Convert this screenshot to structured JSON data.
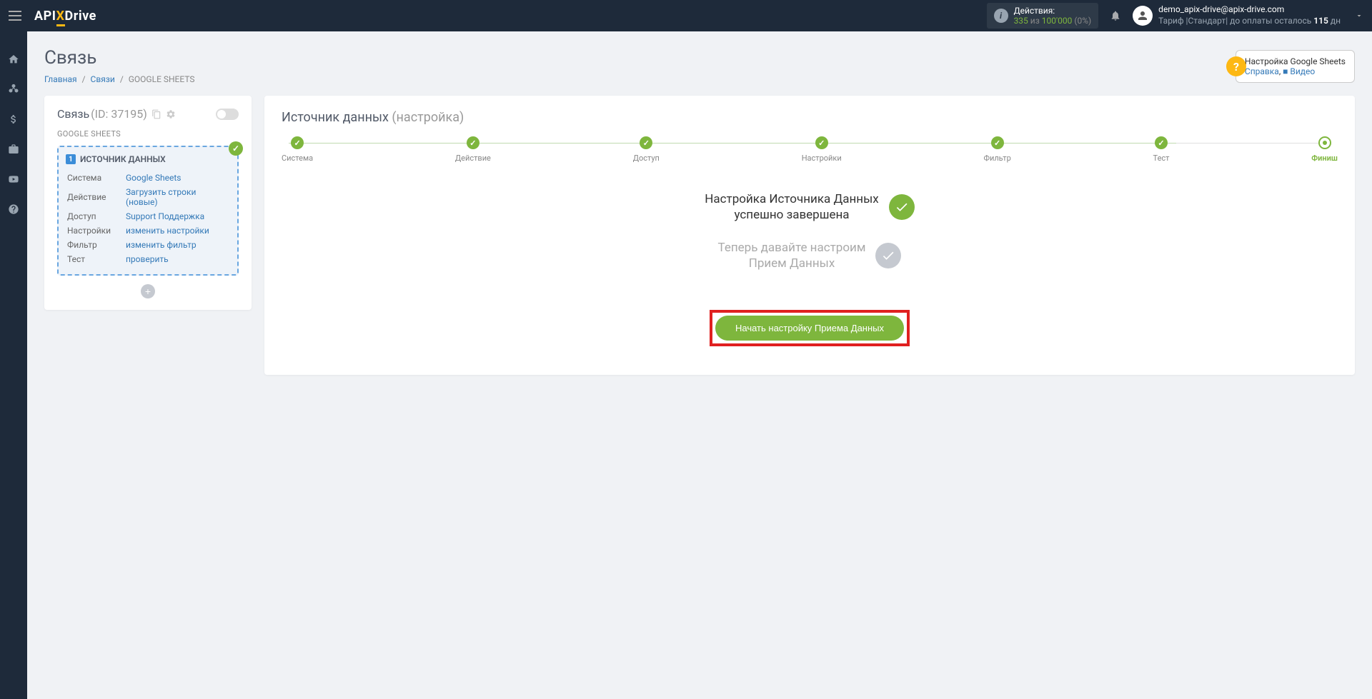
{
  "header": {
    "logo": {
      "api": "API",
      "x": "X",
      "drive": "Drive"
    },
    "actions": {
      "label": "Действия:",
      "used": "335",
      "of": "из",
      "total": "100'000",
      "pct": "(0%)"
    },
    "user": {
      "email": "demo_apix-drive@apix-drive.com",
      "plan_prefix": "Тариф |Стандарт| до оплаты осталось ",
      "days": "115",
      "days_suffix": " дн"
    }
  },
  "page": {
    "title": "Связь",
    "breadcrumb": {
      "home": "Главная",
      "links": "Связи",
      "current": "GOOGLE SHEETS"
    }
  },
  "help": {
    "title": "Настройка Google Sheets",
    "link1": "Справка",
    "comma": ", ",
    "video": "Видео"
  },
  "left": {
    "conn_label": "Связь",
    "conn_id": "(ID: 37195)",
    "service": "GOOGLE SHEETS",
    "source_title": "ИСТОЧНИК ДАННЫХ",
    "rows": [
      {
        "k": "Система",
        "v": "Google Sheets"
      },
      {
        "k": "Действие",
        "v": "Загрузить строки (новые)"
      },
      {
        "k": "Доступ",
        "v": "Support Поддержка"
      },
      {
        "k": "Настройки",
        "v": "изменить настройки"
      },
      {
        "k": "Фильтр",
        "v": "изменить фильтр"
      },
      {
        "k": "Тест",
        "v": "проверить"
      }
    ]
  },
  "right": {
    "title": "Источник данных",
    "subtitle": "(настройка)",
    "steps": [
      "Система",
      "Действие",
      "Доступ",
      "Настройки",
      "Фильтр",
      "Тест",
      "Финиш"
    ],
    "status1_l1": "Настройка Источника Данных",
    "status1_l2": "успешно завершена",
    "status2_l1": "Теперь давайте настроим",
    "status2_l2": "Прием Данных",
    "cta": "Начать настройку Приема Данных"
  }
}
